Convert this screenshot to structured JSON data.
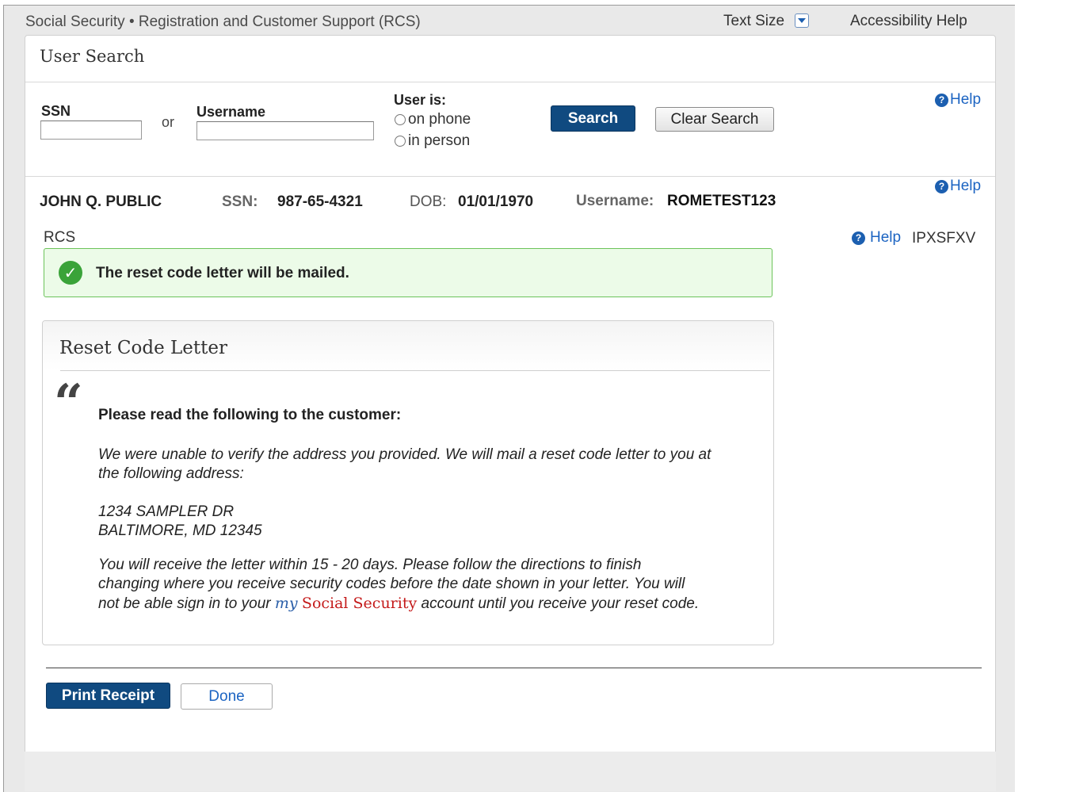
{
  "topbar": {
    "title": "Social Security • Registration and Customer Support (RCS)",
    "text_size_label": "Text Size",
    "accessibility_help": "Accessibility Help"
  },
  "panel": {
    "header": "User Search"
  },
  "search": {
    "ssn_label": "SSN",
    "or_label": "or",
    "username_label": "Username",
    "ssn_value": "",
    "username_value": "",
    "user_is_label": "User is:",
    "radio_phone": "on phone",
    "radio_person": "in person",
    "search_button": "Search",
    "clear_button": "Clear Search",
    "help": "Help"
  },
  "customer": {
    "name": "JOHN Q. PUBLIC",
    "ssn_label": "SSN:",
    "ssn_value": "987-65-4321",
    "dob_label": "DOB:",
    "dob_value": "01/01/1970",
    "username_label": "Username:",
    "username_value": "ROMETEST123",
    "help": "Help"
  },
  "rcs": {
    "label": "RCS",
    "help": "Help",
    "code": "IPXSFXV"
  },
  "alert": {
    "message": "The reset code letter will be mailed."
  },
  "letter": {
    "title": "Reset Code Letter",
    "quote_glyph": "“",
    "read_label": "Please read the following to the customer:",
    "para1_line1": "We were unable to verify the address you provided. We will mail a reset code letter to you at",
    "para1_line2": "the following address:",
    "address_line1": "1234 SAMPLER DR",
    "address_line2": "BALTIMORE, MD 12345",
    "para2_line1": "You will receive the letter within 15 - 20  days. Please follow the directions to finish",
    "para2_line2": "changing where you receive security codes before the date shown in your letter. You will",
    "para2_line3_a": "not be able sign in to your ",
    "para2_my": "my",
    "para2_ss": "Social Security",
    "para2_line3_b": " account until you receive your reset code."
  },
  "actions": {
    "print_receipt": "Print Receipt",
    "done": "Done"
  },
  "colors": {
    "primary_button": "#104a80",
    "link": "#1c64c2",
    "success_bg": "#ecfbe8",
    "success_border": "#6cc35a",
    "brand_red": "#c41a1a"
  },
  "icons": {
    "help": "question-circle-icon",
    "success": "check-circle-icon",
    "text_size": "chevron-down-icon"
  }
}
